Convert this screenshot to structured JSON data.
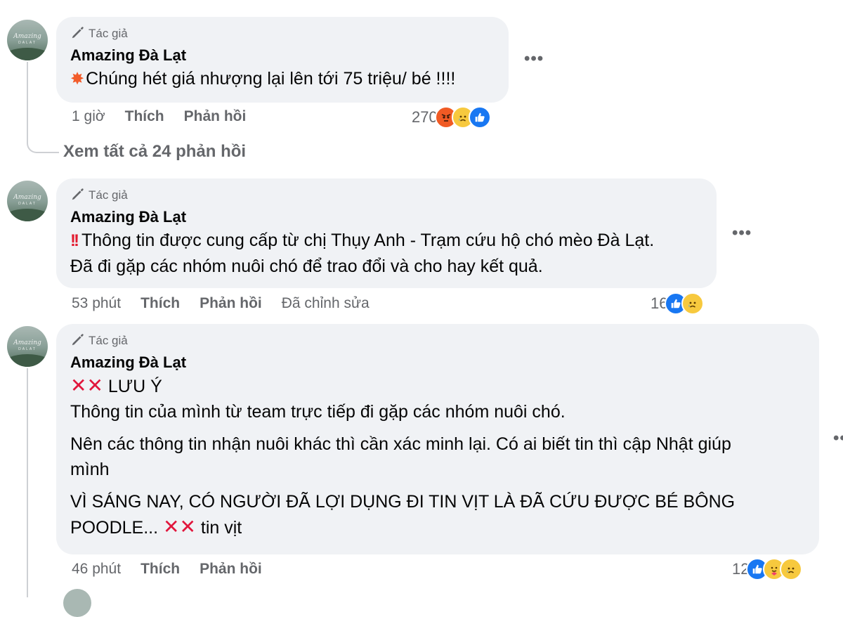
{
  "comments": [
    {
      "badge": "Tác giả",
      "author": "Amazing Đà Lạt",
      "lines": [
        "Chúng hét giá nhượng lại lên tới 75 triệu/ bé !!!!"
      ],
      "time": "1 giờ",
      "like": "Thích",
      "reply": "Phản hồi",
      "edited": "",
      "reaction_count": "270",
      "reactions": [
        "angry",
        "sad",
        "like"
      ]
    },
    {
      "badge": "Tác giả",
      "author": "Amazing Đà Lạt",
      "lines": [
        "Thông tin được cung cấp từ chị Thụy Anh - Trạm cứu hộ chó mèo Đà Lạt.",
        "Đã đi gặp các nhóm nuôi chó để trao đổi và cho hay kết quả."
      ],
      "time": "53 phút",
      "like": "Thích",
      "reply": "Phản hồi",
      "edited": "Đã chỉnh sửa",
      "reaction_count": "16",
      "reactions": [
        "like",
        "sad"
      ]
    },
    {
      "badge": "Tác giả",
      "author": "Amazing Đà Lạt",
      "lines": [
        "LƯU Ý",
        "Thông tin của mình từ team trực tiếp đi gặp các nhóm nuôi chó.",
        "Nên các thông tin nhận nuôi khác thì cần xác minh lại. Có ai biết tin thì cập Nhật giúp",
        "mình",
        "VÌ SÁNG NAY, CÓ NGƯỜI ĐÃ LỢI DỤNG ĐI TIN VỊT LÀ ĐÃ CỨU ĐƯỢC BÉ BÔNG",
        "POODLE...",
        "tin vịt"
      ],
      "time": "46 phút",
      "like": "Thích",
      "reply": "Phản hồi",
      "edited": "",
      "reaction_count": "12",
      "reactions": [
        "like",
        "care",
        "sad"
      ]
    }
  ],
  "view_replies": "Xem tất cả 24 phản hồi",
  "avatar_watermark": "Amazing",
  "avatar_watermark_sub": "DALAT",
  "more_label": "•••",
  "icons": {
    "badge": "pencil-mic-icon",
    "boom": "collision-emoji",
    "double_bang": "double-exclamation-emoji",
    "cross": "cross-mark-emoji"
  },
  "colors": {
    "bubble": "#f0f2f5",
    "meta": "#65676b",
    "like": "#1877f2",
    "angry": "#f05a24",
    "sad": "#f7c93e"
  }
}
